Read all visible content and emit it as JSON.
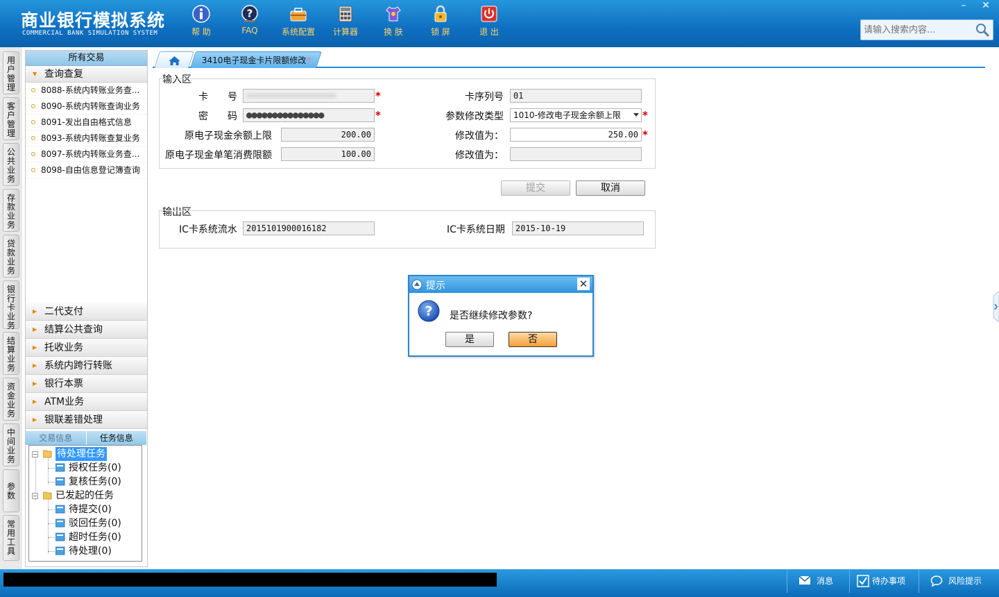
{
  "app": {
    "title_cn": "商业银行模拟系统",
    "title_en": "COMMERCIAL BANK SIMULATION SYSTEM"
  },
  "toolbar": [
    {
      "label": "帮 助",
      "icon": "info-icon"
    },
    {
      "label": "FAQ",
      "icon": "help-question-icon"
    },
    {
      "label": "系统配置",
      "icon": "toolbox-icon"
    },
    {
      "label": "计算器",
      "icon": "calculator-icon"
    },
    {
      "label": "换 肤",
      "icon": "shirt-icon"
    },
    {
      "label": "锁 屏",
      "icon": "lock-icon"
    },
    {
      "label": "退 出",
      "icon": "power-icon"
    }
  ],
  "search": {
    "placeholder": "请输入搜索内容..."
  },
  "window": {
    "minimize": "–",
    "close": "✕"
  },
  "vtabs": [
    "用户管理",
    "客户管理",
    "公共业务",
    "存款业务",
    "贷款业务",
    "银行卡业务",
    "结算业务",
    "资金业务",
    "中间业务",
    "参数",
    "常用工具"
  ],
  "nav": {
    "header": "所有交易",
    "open_group": "查询查复",
    "items": [
      "8088-系统内转账业务查...",
      "8090-系统内转账查询业务",
      "8091-发出自由格式信息",
      "8093-系统内转账查复业务",
      "8097-系统内转账业务查...",
      "8098-自由信息登记簿查询"
    ],
    "groups": [
      "二代支付",
      "结算公共查询",
      "托收业务",
      "系统内跨行转账",
      "银行本票",
      "ATM业务",
      "银联差错处理"
    ]
  },
  "tasks": {
    "tab_trade": "交易信息",
    "tab_task": "任务信息",
    "pending_root": "待处理任务",
    "pending_children": [
      "授权任务(0)",
      "复核任务(0)"
    ],
    "initiated_root": "已发起的任务",
    "initiated_children": [
      "待提交(0)",
      "驳回任务(0)",
      "超时任务(0)",
      "待处理(0)"
    ]
  },
  "tabs": {
    "active": "3410电子现金卡片限额修改",
    "close": "×"
  },
  "form": {
    "input_section": "输入区",
    "card_no_label": "卡　　号",
    "card_seq_label": "卡序列号",
    "card_seq_value": "01",
    "password_label": "密　　码",
    "password_value": "●●●●●●●●●●●●●●●",
    "param_type_label": "参数修改类型",
    "param_type_value": "1010-修改电子现金余额上限",
    "orig_balance_label": "原电子现金余额上限",
    "orig_balance_value": "200.00",
    "modify_to_label_1": "修改值为：",
    "modify_to_value_1": "250.00",
    "orig_single_label": "原电子现金单笔消费限额",
    "orig_single_value": "100.00",
    "modify_to_label_2": "修改值为：",
    "modify_to_value_2": "",
    "submit": "提交",
    "cancel": "取消",
    "output_section": "输出区",
    "ic_serial_label": "IC卡系统流水",
    "ic_serial_value": "2015101900016182",
    "ic_date_label": "IC卡系统日期",
    "ic_date_value": "2015-10-19",
    "required_mark": "*"
  },
  "dialog": {
    "title": "提示",
    "message": "是否继续修改参数?",
    "yes": "是",
    "no": "否",
    "close": "✕"
  },
  "statusbar": {
    "message": "消息",
    "todo": "待办事项",
    "risk": "风险提示"
  },
  "colors": {
    "header_blue": "#1782cf",
    "label_gold": "#ffd36a",
    "required_red": "#d00000",
    "selection_blue": "#3399ff"
  }
}
